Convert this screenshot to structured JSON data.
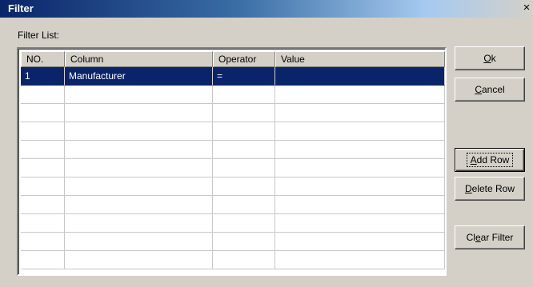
{
  "window": {
    "title": "Filter",
    "close_glyph": "×"
  },
  "list_label": "Filter List:",
  "columns": [
    "NO.",
    "Column",
    "Operator",
    "Value"
  ],
  "rows": [
    {
      "no": "1",
      "column": "Manufacturer",
      "operator": "=",
      "value": "",
      "selected": true
    }
  ],
  "empty_row_count": 10,
  "buttons": {
    "ok": {
      "accel": "O",
      "rest": "k"
    },
    "cancel": {
      "accel": "C",
      "rest": "ancel"
    },
    "add_row": {
      "accel": "A",
      "rest": "dd Row"
    },
    "delete_row": {
      "accel": "D",
      "rest": "elete Row"
    },
    "clear_filter": {
      "pre": "Cl",
      "accel": "e",
      "rest": "ar Filter"
    }
  },
  "colors": {
    "selection": "#0a246a",
    "face": "#d4d0c8",
    "title_start": "#0a246a"
  }
}
